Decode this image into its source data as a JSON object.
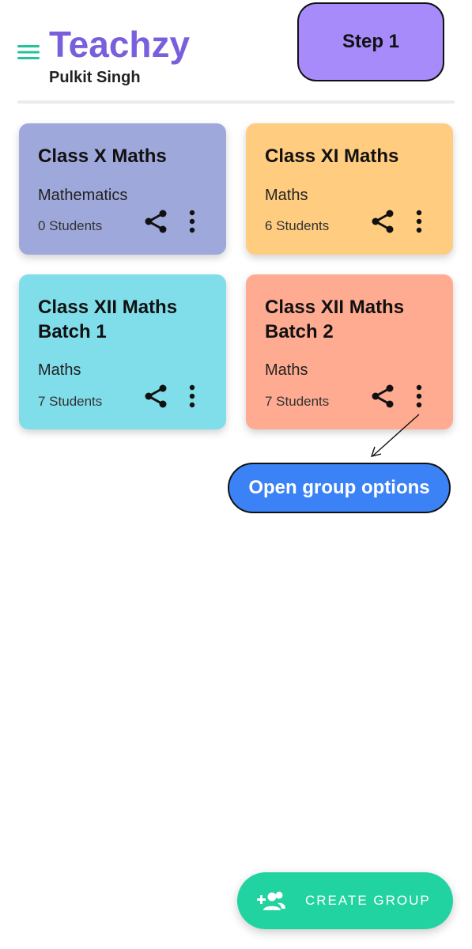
{
  "header": {
    "app_title": "Teachzy",
    "user_name": "Pulkit Singh",
    "step_label": "Step 1"
  },
  "groups": [
    {
      "title": "Class X Maths",
      "subject": "Mathematics",
      "students": "0 Students",
      "color": "#9fa8da"
    },
    {
      "title": "Class XI Maths",
      "subject": "Maths",
      "students": "6 Students",
      "color": "#ffcc80"
    },
    {
      "title": "Class XII Maths Batch 1",
      "subject": "Maths",
      "students": "7 Students",
      "color": "#80deea"
    },
    {
      "title": "Class XII Maths Batch 2",
      "subject": "Maths",
      "students": "7 Students",
      "color": "#ffab91"
    }
  ],
  "tooltip": {
    "text": "Open group options"
  },
  "fab": {
    "label": "CREATE GROUP",
    "icon": "add-group-icon"
  },
  "colors": {
    "brand": "#7a5fdc",
    "step_badge": "#a78bfa",
    "tooltip": "#3b82f6",
    "fab": "#22d3a2",
    "menu_icon": "#22c29a"
  }
}
